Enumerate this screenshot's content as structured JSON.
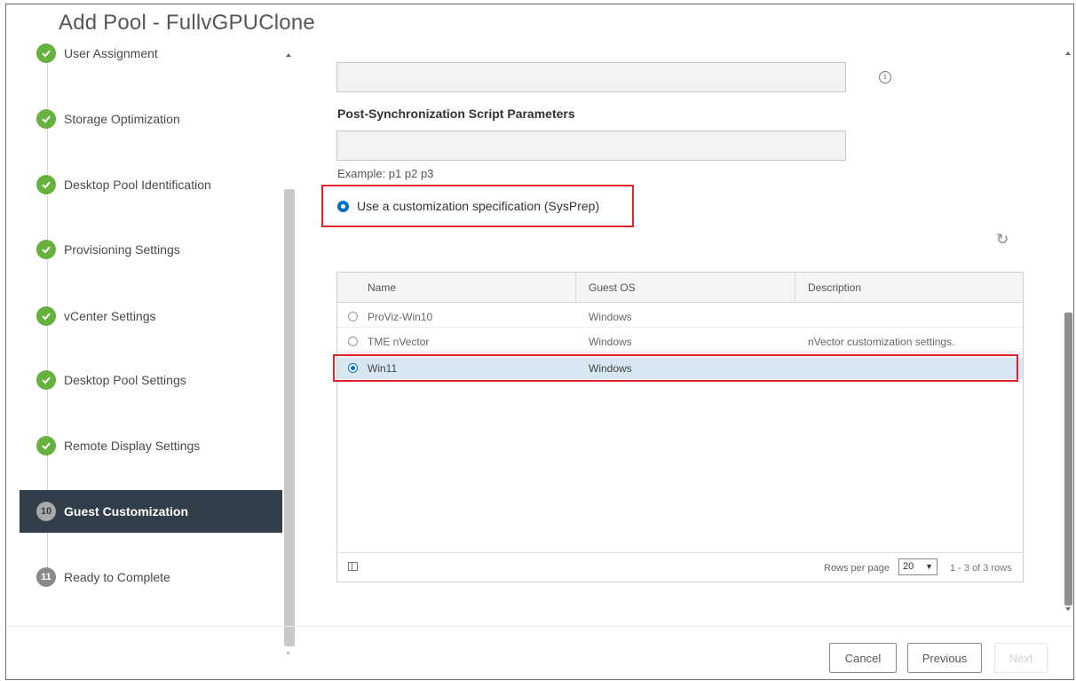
{
  "dialog": {
    "title": "Add Pool - FullvGPUClone"
  },
  "sidebar": {
    "steps": [
      {
        "label": "User Assignment",
        "status": "done"
      },
      {
        "label": "Storage Optimization",
        "status": "done"
      },
      {
        "label": "Desktop Pool Identification",
        "status": "done"
      },
      {
        "label": "Provisioning Settings",
        "status": "done"
      },
      {
        "label": "vCenter Settings",
        "status": "done"
      },
      {
        "label": "Desktop Pool Settings",
        "status": "done"
      },
      {
        "label": "Remote Display Settings",
        "status": "done"
      },
      {
        "label": "Guest Customization",
        "number": "10",
        "status": "active"
      },
      {
        "label": "Ready to Complete",
        "number": "11",
        "status": "pending"
      }
    ]
  },
  "main": {
    "post_sync_label": "Post-Synchronization Script Parameters",
    "example_text": "Example: p1 p2 p3",
    "sysprep_option_label": "Use a customization specification (SysPrep)",
    "grid": {
      "columns": [
        "Name",
        "Guest OS",
        "Description"
      ],
      "rows": [
        {
          "name": "ProViz-Win10",
          "guest_os": "Windows",
          "description": "",
          "selected": false
        },
        {
          "name": "TME nVector",
          "guest_os": "Windows",
          "description": "nVector customization settings.",
          "selected": false
        },
        {
          "name": "Win11",
          "guest_os": "Windows",
          "description": "",
          "selected": true
        }
      ],
      "rows_per_page_label": "Rows per page",
      "rows_per_page_value": "20",
      "pager_count": "1 - 3 of 3 rows"
    }
  },
  "footer": {
    "cancel_label": "Cancel",
    "previous_label": "Previous",
    "next_label": "Next"
  },
  "colors": {
    "accent": "#0073c6",
    "success": "#67b13f",
    "active_step_bg": "#313d48",
    "callout": "#e0262a"
  }
}
